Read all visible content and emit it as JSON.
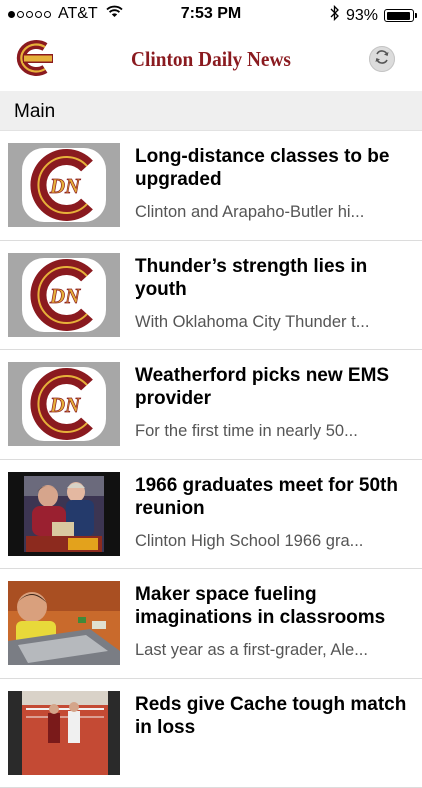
{
  "status_bar": {
    "carrier": "AT&T",
    "time": "7:53 PM",
    "battery": "93%",
    "battery_level": 0.93,
    "signal_bars": 1
  },
  "nav": {
    "title": "Clinton Daily News",
    "logo_icon": "clinton-c-logo",
    "refresh_icon": "refresh-icon"
  },
  "section": {
    "label": "Main"
  },
  "colors": {
    "brand": "#8a1a1f",
    "accent_gold": "#e6b13a"
  },
  "articles": [
    {
      "title": "Long-distance classes to be upgraded",
      "summary": "Clinton and Arapaho-Butler hi...",
      "thumb": "cdn-logo",
      "logo_text": "DN"
    },
    {
      "title": "Thunder’s strength lies in youth",
      "summary": "With Oklahoma City Thunder t...",
      "thumb": "cdn-logo",
      "logo_text": "DN"
    },
    {
      "title": "Weatherford picks new EMS provider",
      "summary": "For the first time in nearly 50...",
      "thumb": "cdn-logo",
      "logo_text": "DN"
    },
    {
      "title": "1966 graduates meet for 50th reunion",
      "summary": "Clinton High School 1966 gra...",
      "thumb": "photo-reunion"
    },
    {
      "title": "Maker space fueling imaginations in classrooms",
      "summary": "Last year as a first-grader, Ale...",
      "thumb": "photo-classroom"
    },
    {
      "title": "Reds give Cache tough match in loss",
      "summary": "",
      "thumb": "photo-volleyball"
    }
  ]
}
